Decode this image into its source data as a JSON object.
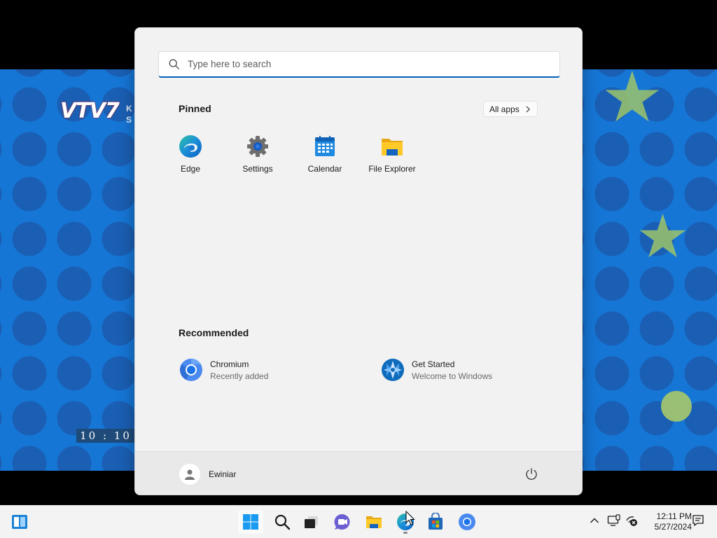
{
  "wallpaper": {
    "channel_logo": "VTV7",
    "channel_subtext": [
      "K",
      "S"
    ],
    "video_clock": "10 : 10"
  },
  "start_menu": {
    "search": {
      "placeholder": "Type here to search",
      "icon": "search-icon"
    },
    "pinned": {
      "title": "Pinned",
      "all_apps_label": "All apps",
      "apps": [
        {
          "label": "Edge",
          "icon": "edge-icon"
        },
        {
          "label": "Settings",
          "icon": "gear-icon"
        },
        {
          "label": "Calendar",
          "icon": "calendar-icon"
        },
        {
          "label": "File Explorer",
          "icon": "folder-icon"
        }
      ]
    },
    "recommended": {
      "title": "Recommended",
      "items": [
        {
          "name": "Chromium",
          "subtitle": "Recently added",
          "icon": "chromium-icon"
        },
        {
          "name": "Get Started",
          "subtitle": "Welcome to Windows",
          "icon": "get-started-icon"
        }
      ]
    },
    "user": {
      "name": "Ewiniar",
      "icon": "avatar-icon"
    },
    "power": {
      "icon": "power-icon"
    }
  },
  "taskbar": {
    "widgets_icon": "widgets-icon",
    "apps": [
      {
        "name": "start",
        "icon": "windows-logo-icon",
        "active": true
      },
      {
        "name": "search",
        "icon": "search-icon"
      },
      {
        "name": "task-view",
        "icon": "task-view-icon"
      },
      {
        "name": "chat",
        "icon": "teams-chat-icon"
      },
      {
        "name": "file-explorer",
        "icon": "folder-icon"
      },
      {
        "name": "edge",
        "icon": "edge-icon",
        "running": true
      },
      {
        "name": "store",
        "icon": "store-icon"
      },
      {
        "name": "chromium",
        "icon": "chromium-icon"
      }
    ],
    "tray": {
      "icons": [
        "chevron-up-icon",
        "display-icon",
        "network-disconnected-icon"
      ],
      "time": "12:11 PM",
      "date": "5/27/2024",
      "notification_icon": "notification-icon"
    }
  },
  "colors": {
    "accent": "#005fb8",
    "wallpaper_blue": "#1676d6",
    "start_bg": "#f2f2f2",
    "taskbar_bg": "#f3f3f3"
  }
}
